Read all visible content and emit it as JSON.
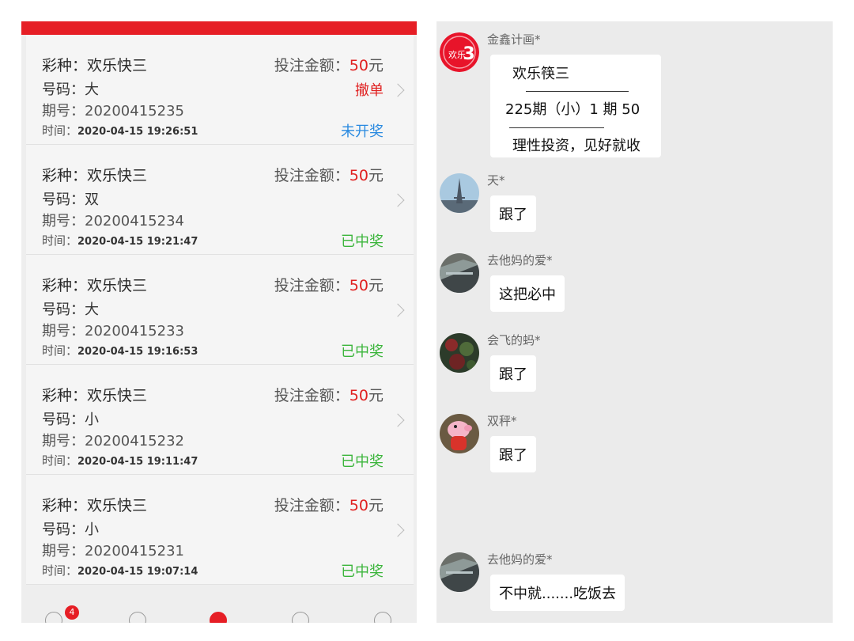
{
  "bet_records": [
    {
      "lottery_label": "彩种：欢乐快三",
      "amount_prefix": "投注金额：",
      "amount_value": "50",
      "amount_unit": "元",
      "number_label": "号码：大",
      "issue_label": "期号：20200415235",
      "time_prefix": "时间：",
      "time_value": "2020-04-15 19:26:51",
      "action": "撤单",
      "status": "未开奖",
      "status_type": "pending"
    },
    {
      "lottery_label": "彩种：欢乐快三",
      "amount_prefix": "投注金额：",
      "amount_value": "50",
      "amount_unit": "元",
      "number_label": "号码：双",
      "issue_label": "期号：20200415234",
      "time_prefix": "时间：",
      "time_value": "2020-04-15 19:21:47",
      "action": "",
      "status": "已中奖",
      "status_type": "won"
    },
    {
      "lottery_label": "彩种：欢乐快三",
      "amount_prefix": "投注金额：",
      "amount_value": "50",
      "amount_unit": "元",
      "number_label": "号码：大",
      "issue_label": "期号：20200415233",
      "time_prefix": "时间：",
      "time_value": "2020-04-15 19:16:53",
      "action": "",
      "status": "已中奖",
      "status_type": "won"
    },
    {
      "lottery_label": "彩种：欢乐快三",
      "amount_prefix": "投注金额：",
      "amount_value": "50",
      "amount_unit": "元",
      "number_label": "号码：小",
      "issue_label": "期号：20200415232",
      "time_prefix": "时间：",
      "time_value": "2020-04-15 19:11:47",
      "action": "",
      "status": "已中奖",
      "status_type": "won"
    },
    {
      "lottery_label": "彩种：欢乐快三",
      "amount_prefix": "投注金额：",
      "amount_value": "50",
      "amount_unit": "元",
      "number_label": "号码：小",
      "issue_label": "期号：20200415231",
      "time_prefix": "时间：",
      "time_value": "2020-04-15 19:07:14",
      "action": "",
      "status": "已中奖",
      "status_type": "won"
    }
  ],
  "bottom_nav": {
    "badge_count": "4",
    "icons": [
      "home-icon",
      "user-icon",
      "lottery-icon",
      "compass-icon",
      "profile-icon"
    ]
  },
  "chat": {
    "messages": [
      {
        "sender": "金鑫计画*",
        "avatar": "lottery-logo-avatar",
        "plan": {
          "line1": "欢乐筷三",
          "line2": "225期（小）1 期 50",
          "line3": "理性投资，见好就收"
        }
      },
      {
        "sender": "天*",
        "avatar": "tower-avatar",
        "text": "跟了"
      },
      {
        "sender": "去他妈的爱*",
        "avatar": "landscape-avatar",
        "text": "这把必中"
      },
      {
        "sender": "会飞的蚂*",
        "avatar": "plant-avatar",
        "text": "跟了"
      },
      {
        "sender": "双秤*",
        "avatar": "cartoon-pig-avatar",
        "text": "跟了"
      },
      {
        "sender": "去他妈的爱*",
        "avatar": "landscape-avatar",
        "text": "不中就.......吃饭去"
      }
    ]
  },
  "colors": {
    "brand_red": "#e61e25",
    "amount_red": "#e02020",
    "pending_blue": "#2a8ae0",
    "won_green": "#3bb53b"
  }
}
